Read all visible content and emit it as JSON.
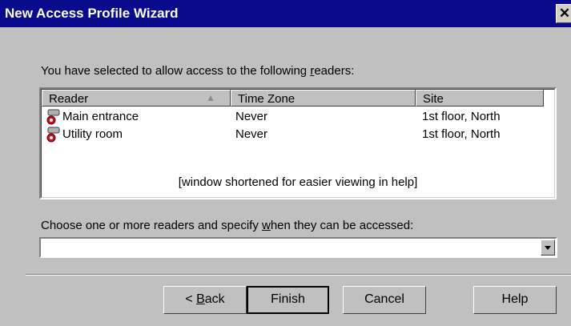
{
  "window": {
    "title": "New Access Profile Wizard",
    "close_glyph": "✕"
  },
  "intro": {
    "before": "You have selected to allow access to the following ",
    "accel": "r",
    "after": "eaders:"
  },
  "list": {
    "columns": [
      "Reader",
      "Time Zone",
      "Site"
    ],
    "rows": [
      {
        "reader": "Main entrance",
        "time_zone": "Never",
        "site": "1st floor, North",
        "icon": "reader-key-icon"
      },
      {
        "reader": "Utility room",
        "time_zone": "Never",
        "site": "1st floor, North",
        "icon": "reader-key-icon"
      }
    ],
    "note": "[window shortened for easier viewing in  help]"
  },
  "choose": {
    "before": "Choose one or more readers and specify ",
    "accel": "w",
    "after": "hen they can be accessed:"
  },
  "combo": {
    "value": ""
  },
  "buttons": {
    "back": {
      "before": "< ",
      "accel": "B",
      "after": "ack"
    },
    "finish": "Finish",
    "cancel": "Cancel",
    "help": "Help"
  },
  "colors": {
    "titlebar": "#0a0a8c",
    "face": "#c0c0c0",
    "key_red": "#c8102e"
  }
}
